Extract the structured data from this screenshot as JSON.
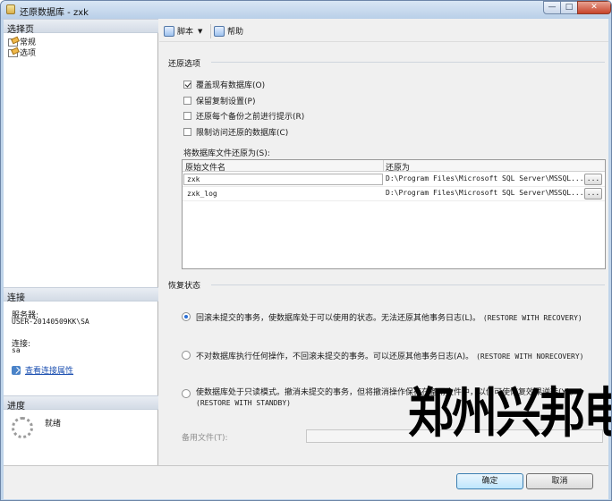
{
  "window": {
    "title": "还原数据库 - zxk",
    "controls": [
      "minimize",
      "maximize",
      "close"
    ]
  },
  "left_pane": {
    "select_page_header": "选择页",
    "pages": [
      {
        "label": "常规",
        "icon": "page-icon"
      },
      {
        "label": "选项",
        "icon": "page-icon"
      }
    ],
    "connection": {
      "header": "连接",
      "server_label": "服务器:",
      "server_value": "USER-20140509KK\\SA",
      "connection_label": "连接:",
      "connection_value": "sa",
      "view_properties_link": "查看连接属性"
    },
    "progress": {
      "header": "进度",
      "status": "就绪"
    }
  },
  "toolbar": {
    "script_label": "脚本",
    "help_label": "帮助"
  },
  "restore_options": {
    "title": "还原选项",
    "checkboxes": [
      {
        "label": "覆盖现有数据库(O)",
        "checked": true
      },
      {
        "label": "保留复制设置(P)",
        "checked": false
      },
      {
        "label": "还原每个备份之前进行提示(R)",
        "checked": false
      },
      {
        "label": "限制访问还原的数据库(C)",
        "checked": false
      }
    ],
    "files_label": "将数据库文件还原为(S):",
    "columns": [
      "原始文件名",
      "还原为"
    ],
    "rows": [
      {
        "original": "zxk",
        "restore_as": "D:\\Program Files\\Microsoft SQL Server\\MSSQL...",
        "browse": "..."
      },
      {
        "original": "zxk_log",
        "restore_as": "D:\\Program Files\\Microsoft SQL Server\\MSSQL...",
        "browse": "..."
      }
    ]
  },
  "recovery_state": {
    "title": "恢复状态",
    "options": [
      {
        "text": "回滚未提交的事务，使数据库处于可以使用的状态。无法还原其他事务日志(L)。",
        "mode": "(RESTORE WITH RECOVERY)",
        "selected": true
      },
      {
        "text": "不对数据库执行任何操作，不回滚未提交的事务。可以还原其他事务日志(A)。",
        "mode": "(RESTORE WITH NORECOVERY)",
        "selected": false
      },
      {
        "text": "使数据库处于只读模式。撤消未提交的事务，但将撤消操作保存在备用文件中，以便可使恢复效果逆转(Y)。",
        "mode": "(RESTORE WITH STANDBY)",
        "selected": false
      }
    ],
    "standby_file_label": "备用文件(T):",
    "standby_file_value": ""
  },
  "buttons": {
    "ok": "确定",
    "cancel": "取消"
  },
  "watermark": "郑州兴邦电子",
  "colors": {
    "accent": "#2a6fd6",
    "link": "#1b4fb0",
    "title_bar": "#bfd4ea"
  }
}
